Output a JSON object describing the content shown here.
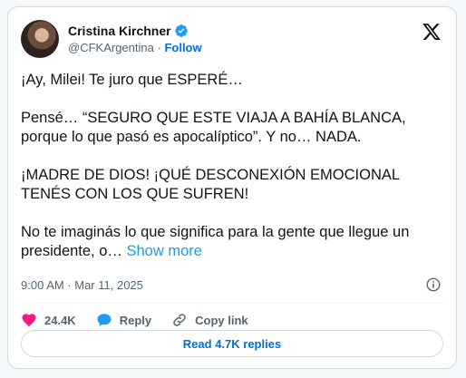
{
  "author": {
    "name": "Cristina Kirchner",
    "handle": "@CFKArgentina",
    "separator": "·",
    "follow_label": "Follow"
  },
  "tweet": {
    "paragraphs": [
      "¡Ay, Milei! Te juro que ESPERÉ…",
      "Pensé… “SEGURO QUE ESTE VIAJA A BAHÍA BLANCA, porque lo que pasó es apocalíptico”. Y no… NADA.",
      "¡MADRE DE DIOS! ¡QUÉ DESCONEXIÓN EMOCIONAL TENÉS CON LOS QUE SUFREN!",
      "No te imaginás lo que significa para la gente que llegue un presidente, o…"
    ],
    "show_more_label": "Show more",
    "timestamp": "9:00 AM · Mar 11, 2025"
  },
  "actions": {
    "likes": "24.4K",
    "reply_label": "Reply",
    "copy_link_label": "Copy link"
  },
  "replies_button": {
    "label": "Read 4.7K replies"
  },
  "icons": {
    "verified": "verified-badge-icon",
    "x_logo": "x-logo-icon",
    "info": "info-icon",
    "heart": "heart-icon",
    "reply": "reply-bubble-icon",
    "link": "link-icon"
  },
  "colors": {
    "accent": "#1d9bf0",
    "heart": "#f91880",
    "text": "#0f1419",
    "muted": "#536471"
  }
}
